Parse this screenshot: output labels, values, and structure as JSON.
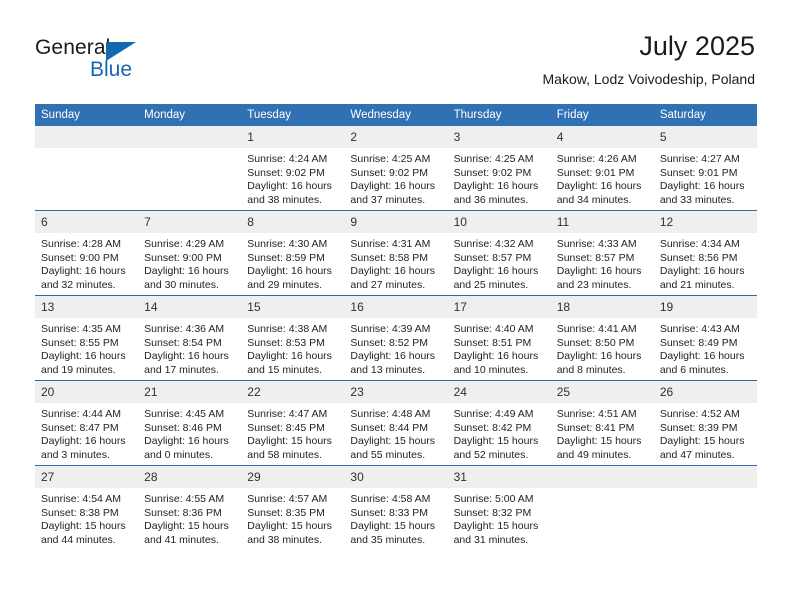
{
  "brand": {
    "name_part1": "General",
    "name_part2": "Blue",
    "accent_color": "#1568b0"
  },
  "header": {
    "title": "July 2025",
    "location": "Makow, Lodz Voivodeship, Poland",
    "header_bg_color": "#3071b4",
    "row_divider_color": "#2a6bad",
    "daynum_bg_color": "#efefef"
  },
  "weekday_headers": [
    "Sunday",
    "Monday",
    "Tuesday",
    "Wednesday",
    "Thursday",
    "Friday",
    "Saturday"
  ],
  "weeks": [
    [
      {
        "day": "",
        "empty": true,
        "sunrise": "",
        "sunset": "",
        "daylight_line1": "",
        "daylight_line2": ""
      },
      {
        "day": "",
        "empty": true,
        "sunrise": "",
        "sunset": "",
        "daylight_line1": "",
        "daylight_line2": ""
      },
      {
        "day": "1",
        "sunrise": "Sunrise: 4:24 AM",
        "sunset": "Sunset: 9:02 PM",
        "daylight_line1": "Daylight: 16 hours",
        "daylight_line2": "and 38 minutes."
      },
      {
        "day": "2",
        "sunrise": "Sunrise: 4:25 AM",
        "sunset": "Sunset: 9:02 PM",
        "daylight_line1": "Daylight: 16 hours",
        "daylight_line2": "and 37 minutes."
      },
      {
        "day": "3",
        "sunrise": "Sunrise: 4:25 AM",
        "sunset": "Sunset: 9:02 PM",
        "daylight_line1": "Daylight: 16 hours",
        "daylight_line2": "and 36 minutes."
      },
      {
        "day": "4",
        "sunrise": "Sunrise: 4:26 AM",
        "sunset": "Sunset: 9:01 PM",
        "daylight_line1": "Daylight: 16 hours",
        "daylight_line2": "and 34 minutes."
      },
      {
        "day": "5",
        "sunrise": "Sunrise: 4:27 AM",
        "sunset": "Sunset: 9:01 PM",
        "daylight_line1": "Daylight: 16 hours",
        "daylight_line2": "and 33 minutes."
      }
    ],
    [
      {
        "day": "6",
        "sunrise": "Sunrise: 4:28 AM",
        "sunset": "Sunset: 9:00 PM",
        "daylight_line1": "Daylight: 16 hours",
        "daylight_line2": "and 32 minutes."
      },
      {
        "day": "7",
        "sunrise": "Sunrise: 4:29 AM",
        "sunset": "Sunset: 9:00 PM",
        "daylight_line1": "Daylight: 16 hours",
        "daylight_line2": "and 30 minutes."
      },
      {
        "day": "8",
        "sunrise": "Sunrise: 4:30 AM",
        "sunset": "Sunset: 8:59 PM",
        "daylight_line1": "Daylight: 16 hours",
        "daylight_line2": "and 29 minutes."
      },
      {
        "day": "9",
        "sunrise": "Sunrise: 4:31 AM",
        "sunset": "Sunset: 8:58 PM",
        "daylight_line1": "Daylight: 16 hours",
        "daylight_line2": "and 27 minutes."
      },
      {
        "day": "10",
        "sunrise": "Sunrise: 4:32 AM",
        "sunset": "Sunset: 8:57 PM",
        "daylight_line1": "Daylight: 16 hours",
        "daylight_line2": "and 25 minutes."
      },
      {
        "day": "11",
        "sunrise": "Sunrise: 4:33 AM",
        "sunset": "Sunset: 8:57 PM",
        "daylight_line1": "Daylight: 16 hours",
        "daylight_line2": "and 23 minutes."
      },
      {
        "day": "12",
        "sunrise": "Sunrise: 4:34 AM",
        "sunset": "Sunset: 8:56 PM",
        "daylight_line1": "Daylight: 16 hours",
        "daylight_line2": "and 21 minutes."
      }
    ],
    [
      {
        "day": "13",
        "sunrise": "Sunrise: 4:35 AM",
        "sunset": "Sunset: 8:55 PM",
        "daylight_line1": "Daylight: 16 hours",
        "daylight_line2": "and 19 minutes."
      },
      {
        "day": "14",
        "sunrise": "Sunrise: 4:36 AM",
        "sunset": "Sunset: 8:54 PM",
        "daylight_line1": "Daylight: 16 hours",
        "daylight_line2": "and 17 minutes."
      },
      {
        "day": "15",
        "sunrise": "Sunrise: 4:38 AM",
        "sunset": "Sunset: 8:53 PM",
        "daylight_line1": "Daylight: 16 hours",
        "daylight_line2": "and 15 minutes."
      },
      {
        "day": "16",
        "sunrise": "Sunrise: 4:39 AM",
        "sunset": "Sunset: 8:52 PM",
        "daylight_line1": "Daylight: 16 hours",
        "daylight_line2": "and 13 minutes."
      },
      {
        "day": "17",
        "sunrise": "Sunrise: 4:40 AM",
        "sunset": "Sunset: 8:51 PM",
        "daylight_line1": "Daylight: 16 hours",
        "daylight_line2": "and 10 minutes."
      },
      {
        "day": "18",
        "sunrise": "Sunrise: 4:41 AM",
        "sunset": "Sunset: 8:50 PM",
        "daylight_line1": "Daylight: 16 hours",
        "daylight_line2": "and 8 minutes."
      },
      {
        "day": "19",
        "sunrise": "Sunrise: 4:43 AM",
        "sunset": "Sunset: 8:49 PM",
        "daylight_line1": "Daylight: 16 hours",
        "daylight_line2": "and 6 minutes."
      }
    ],
    [
      {
        "day": "20",
        "sunrise": "Sunrise: 4:44 AM",
        "sunset": "Sunset: 8:47 PM",
        "daylight_line1": "Daylight: 16 hours",
        "daylight_line2": "and 3 minutes."
      },
      {
        "day": "21",
        "sunrise": "Sunrise: 4:45 AM",
        "sunset": "Sunset: 8:46 PM",
        "daylight_line1": "Daylight: 16 hours",
        "daylight_line2": "and 0 minutes."
      },
      {
        "day": "22",
        "sunrise": "Sunrise: 4:47 AM",
        "sunset": "Sunset: 8:45 PM",
        "daylight_line1": "Daylight: 15 hours",
        "daylight_line2": "and 58 minutes."
      },
      {
        "day": "23",
        "sunrise": "Sunrise: 4:48 AM",
        "sunset": "Sunset: 8:44 PM",
        "daylight_line1": "Daylight: 15 hours",
        "daylight_line2": "and 55 minutes."
      },
      {
        "day": "24",
        "sunrise": "Sunrise: 4:49 AM",
        "sunset": "Sunset: 8:42 PM",
        "daylight_line1": "Daylight: 15 hours",
        "daylight_line2": "and 52 minutes."
      },
      {
        "day": "25",
        "sunrise": "Sunrise: 4:51 AM",
        "sunset": "Sunset: 8:41 PM",
        "daylight_line1": "Daylight: 15 hours",
        "daylight_line2": "and 49 minutes."
      },
      {
        "day": "26",
        "sunrise": "Sunrise: 4:52 AM",
        "sunset": "Sunset: 8:39 PM",
        "daylight_line1": "Daylight: 15 hours",
        "daylight_line2": "and 47 minutes."
      }
    ],
    [
      {
        "day": "27",
        "sunrise": "Sunrise: 4:54 AM",
        "sunset": "Sunset: 8:38 PM",
        "daylight_line1": "Daylight: 15 hours",
        "daylight_line2": "and 44 minutes."
      },
      {
        "day": "28",
        "sunrise": "Sunrise: 4:55 AM",
        "sunset": "Sunset: 8:36 PM",
        "daylight_line1": "Daylight: 15 hours",
        "daylight_line2": "and 41 minutes."
      },
      {
        "day": "29",
        "sunrise": "Sunrise: 4:57 AM",
        "sunset": "Sunset: 8:35 PM",
        "daylight_line1": "Daylight: 15 hours",
        "daylight_line2": "and 38 minutes."
      },
      {
        "day": "30",
        "sunrise": "Sunrise: 4:58 AM",
        "sunset": "Sunset: 8:33 PM",
        "daylight_line1": "Daylight: 15 hours",
        "daylight_line2": "and 35 minutes."
      },
      {
        "day": "31",
        "sunrise": "Sunrise: 5:00 AM",
        "sunset": "Sunset: 8:32 PM",
        "daylight_line1": "Daylight: 15 hours",
        "daylight_line2": "and 31 minutes."
      },
      {
        "day": "",
        "empty": true,
        "sunrise": "",
        "sunset": "",
        "daylight_line1": "",
        "daylight_line2": ""
      },
      {
        "day": "",
        "empty": true,
        "sunrise": "",
        "sunset": "",
        "daylight_line1": "",
        "daylight_line2": ""
      }
    ]
  ]
}
